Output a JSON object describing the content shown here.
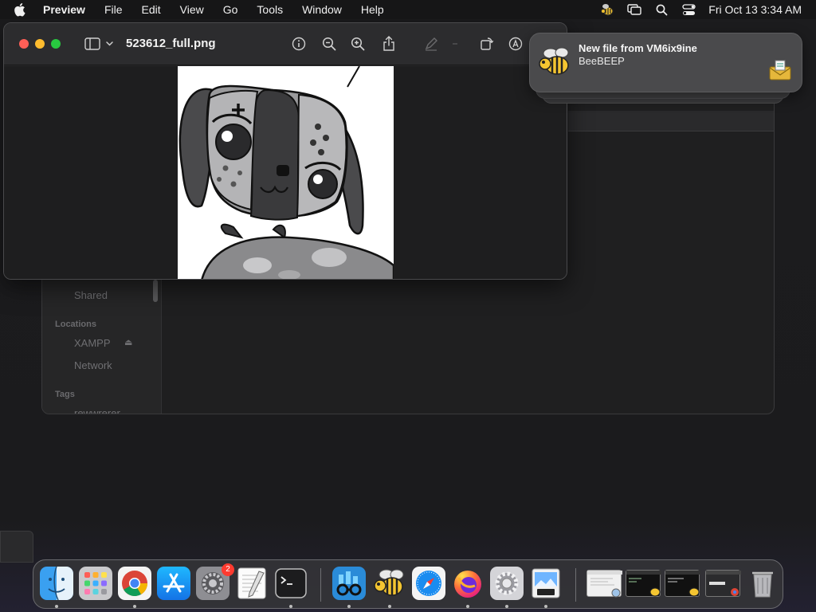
{
  "menubar": {
    "app_name": "Preview",
    "items": [
      "File",
      "Edit",
      "View",
      "Go",
      "Tools",
      "Window",
      "Help"
    ],
    "clock": "Fri Oct 13  3:34 AM",
    "status_icons": [
      "beebeep-icon",
      "screen-mirroring-icon",
      "spotlight-search-icon",
      "control-center-icon"
    ]
  },
  "preview": {
    "title": "523612_full.png",
    "toolbar_icons": [
      "sidebar-toggle-icon",
      "info-icon",
      "zoom-out-icon",
      "zoom-in-icon",
      "share-icon",
      "markup-icon",
      "rotate-icon",
      "annotate-icon"
    ]
  },
  "finder": {
    "sidebar": {
      "shared_label": "Shared",
      "locations_header": "Locations",
      "locations": [
        "XAMPP",
        "Network"
      ],
      "tags_header": "Tags",
      "tags": [
        "rewwrerer"
      ]
    }
  },
  "notification": {
    "title": "New file from VM6ix9ine",
    "body": "BeeBEEP",
    "app_icon": "bee-icon",
    "attachment_icon": "envelope-attachment-icon"
  },
  "dock": {
    "apps": [
      "finder",
      "launchpad",
      "chrome",
      "app-store",
      "system-settings",
      "textedit",
      "terminal",
      "onyx-or-glasses",
      "beebeep",
      "safari",
      "firefox",
      "system-preferences",
      "preview"
    ],
    "badge_system_settings": "2",
    "thumbnails": [
      "window-thumb-1",
      "window-thumb-2",
      "window-thumb-3",
      "window-thumb-4"
    ],
    "trash": "trash-icon"
  },
  "colors": {
    "close": "#fe5f57",
    "minimize": "#febc2e",
    "maximize": "#28c840",
    "badge": "#ff3b30"
  }
}
